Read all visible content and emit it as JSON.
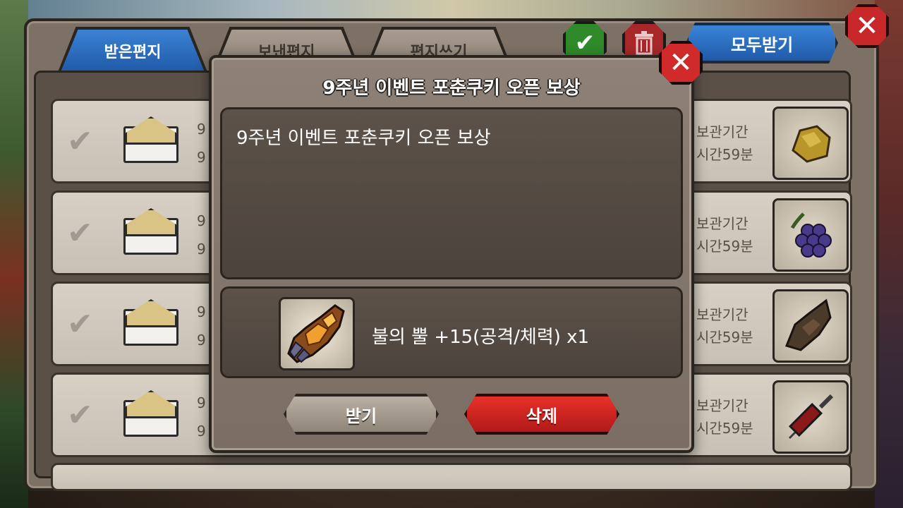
{
  "tabs": [
    {
      "label": "받은편지",
      "active": true
    },
    {
      "label": "보낸편지",
      "active": false
    },
    {
      "label": "편지쓰기",
      "active": false
    }
  ],
  "toolbar": {
    "confirm_icon": "check-icon",
    "trash_icon": "trash-icon",
    "receive_all_label": "모두받기",
    "close_icon": "close-icon"
  },
  "mail_rows": [
    {
      "date_line1": "9",
      "date_line2": "9",
      "keep_line1": "보관기간",
      "keep_line2": "시간59분",
      "item_icon": "ore-icon"
    },
    {
      "date_line1": "9",
      "date_line2": "9",
      "keep_line1": "보관기간",
      "keep_line2": "시간59분",
      "item_icon": "grape-icon"
    },
    {
      "date_line1": "9",
      "date_line2": "9",
      "keep_line1": "보관기간",
      "keep_line2": "시간59분",
      "item_icon": "horn-icon"
    },
    {
      "date_line1": "9",
      "date_line2": "9",
      "keep_line1": "보관기간",
      "keep_line2": "시간59분",
      "item_icon": "syringe-icon"
    }
  ],
  "modal": {
    "title": "9주년 이벤트 포춘쿠키 오픈 보상",
    "body": "9주년 이벤트 포춘쿠키 오픈 보상",
    "reward_name": "불의 뿔 +15(공격/체력) x1",
    "reward_icon": "fire-horn-icon",
    "receive_label": "받기",
    "delete_label": "삭제"
  },
  "colors": {
    "tab_active": "#2f6fc0",
    "delete_button": "#d0241f",
    "confirm_button": "#2f8a2a"
  }
}
